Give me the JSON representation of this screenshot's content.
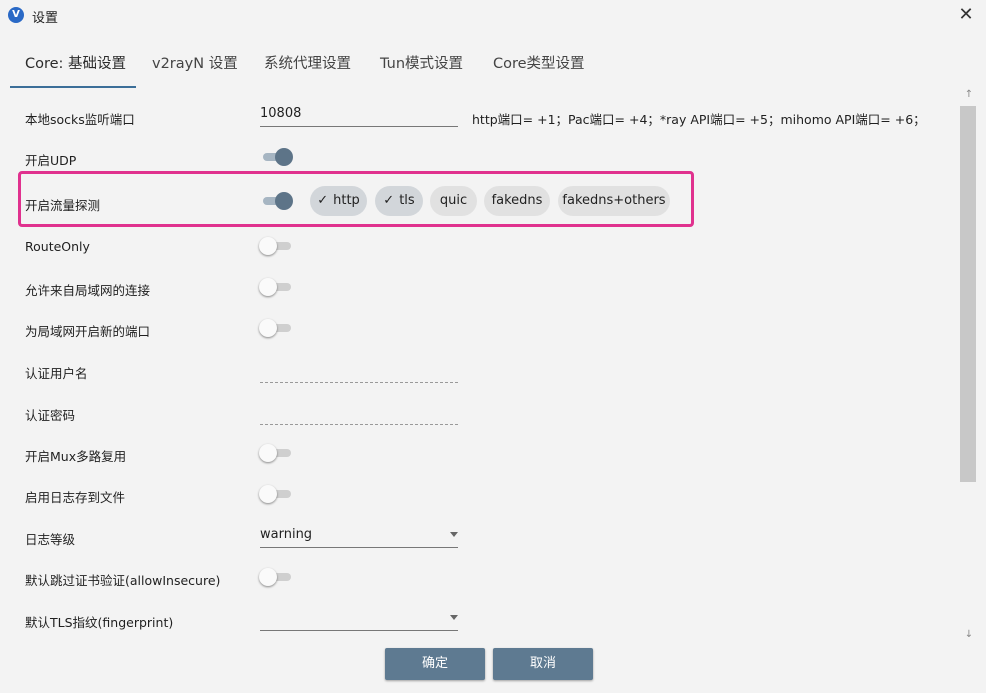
{
  "window": {
    "title": "设置",
    "close_glyph": "✕",
    "app_icon": "v2rayn-logo-icon"
  },
  "tabs": [
    {
      "label": "Core: 基础设置",
      "active": true
    },
    {
      "label": "v2rayN 设置"
    },
    {
      "label": "系统代理设置"
    },
    {
      "label": "Tun模式设置"
    },
    {
      "label": "Core类型设置"
    }
  ],
  "settings": {
    "socks_port": {
      "label": "本地socks监听端口",
      "value": "10808",
      "hint": "http端口= +1；Pac端口= +4；*ray API端口= +5；mihomo API端口= +6；"
    },
    "udp": {
      "label": "开启UDP",
      "on": true
    },
    "sniffing": {
      "label": "开启流量探测",
      "on": true,
      "options": [
        {
          "label": "http",
          "selected": true
        },
        {
          "label": "tls",
          "selected": true
        },
        {
          "label": "quic",
          "selected": false
        },
        {
          "label": "fakedns",
          "selected": false
        },
        {
          "label": "fakedns+others",
          "selected": false
        }
      ]
    },
    "route_only": {
      "label": "RouteOnly",
      "on": false
    },
    "allow_lan": {
      "label": "允许来自局域网的连接",
      "on": false
    },
    "new_port_lan": {
      "label": "为局域网开启新的端口",
      "on": false
    },
    "auth_user": {
      "label": "认证用户名",
      "value": ""
    },
    "auth_pass": {
      "label": "认证密码",
      "value": ""
    },
    "mux": {
      "label": "开启Mux多路复用",
      "on": false
    },
    "log_to_file": {
      "label": "启用日志存到文件",
      "on": false
    },
    "log_level": {
      "label": "日志等级",
      "value": "warning"
    },
    "allow_insecure": {
      "label": "默认跳过证书验证(allowInsecure)",
      "on": false
    },
    "fingerprint": {
      "label": "默认TLS指纹(fingerprint)",
      "value": ""
    }
  },
  "scroll": {
    "up": "↑",
    "down": "↓"
  },
  "buttons": {
    "ok": "确定",
    "cancel": "取消"
  },
  "colors": {
    "accent": "#5e7a91",
    "highlight": "#e0318e"
  }
}
